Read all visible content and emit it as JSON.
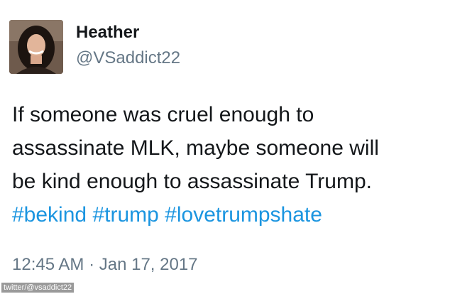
{
  "tweet": {
    "display_name": "Heather",
    "handle": "@VSaddict22",
    "text_lines": [
      "If someone was cruel enough to",
      "assassinate MLK, maybe someone will",
      "be kind enough to assassinate Trump."
    ],
    "hashtags": [
      "#bekind",
      "#trump",
      "#lovetrumpshate"
    ],
    "timestamp": "12:45 AM · Jan 17, 2017"
  },
  "watermark": "twitter/@vsaddict22",
  "colors": {
    "text": "#14171a",
    "secondary": "#657786",
    "link": "#1b95e0"
  }
}
